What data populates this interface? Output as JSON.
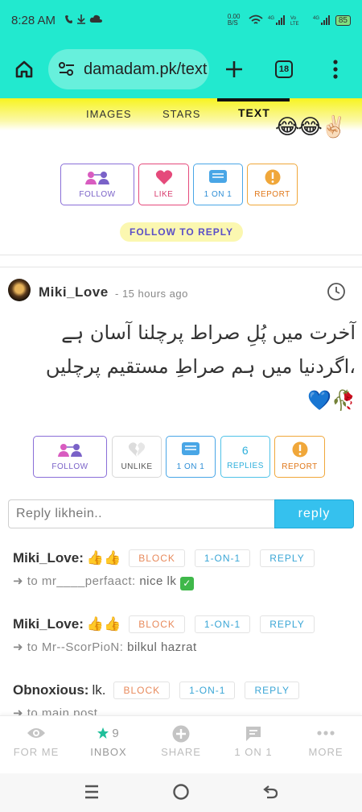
{
  "status_bar": {
    "time": "8:28 AM",
    "network_speed": "0.00 B/S",
    "battery": "85"
  },
  "browser": {
    "url": "damadam.pk/text",
    "tab_count": "18"
  },
  "nav_tabs": [
    {
      "label": "IMAGES"
    },
    {
      "label": "STARS"
    },
    {
      "label": "TEXT"
    }
  ],
  "top_emojis": "😂😂✌🏻",
  "prev_post_actions": {
    "follow": "FOLLOW",
    "like": "LIKE",
    "one_on_one": "1 ON 1",
    "report": "REPORT",
    "follow_to_reply": "FOLLOW TO REPLY"
  },
  "post": {
    "username": "Miki_Love",
    "time": "- 15 hours ago",
    "text_line1": "آخرت میں پُلِ صراط پرچلنا آسان ہے",
    "text_line2": "،اگردنیا میں ہم صراطِ مستقیم پرچلیں",
    "text_line3": "🥀💙",
    "actions": {
      "follow": "FOLLOW",
      "unlike": "UNLIKE",
      "one_on_one": "1 ON 1",
      "replies_count": "6",
      "replies": "REPLIES",
      "report": "REPORT"
    }
  },
  "reply_form": {
    "placeholder": "Reply likhein..",
    "button": "reply"
  },
  "comments": [
    {
      "name": "Miki_Love:",
      "text": "👍👍",
      "block": "BLOCK",
      "one_on_one": "1-ON-1",
      "reply": "REPLY",
      "arrow": "➜ to",
      "target": "mr____perfaact:",
      "message": "nice lk",
      "has_check": true
    },
    {
      "name": "Miki_Love:",
      "text": "👍👍",
      "block": "BLOCK",
      "one_on_one": "1-ON-1",
      "reply": "REPLY",
      "arrow": "➜ to",
      "target": "Mr--ScorPioN:",
      "message": "bilkul hazrat",
      "has_check": false
    },
    {
      "name": "Obnoxious:",
      "text": "lk.",
      "block": "BLOCK",
      "one_on_one": "1-ON-1",
      "reply": "REPLY",
      "arrow": "➜ to",
      "target": "main post",
      "message": "",
      "has_check": false
    }
  ],
  "bottom_nav": [
    {
      "label": "FOR ME",
      "icon": "eye-icon"
    },
    {
      "label": "INBOX",
      "icon": "star-icon",
      "count": "9"
    },
    {
      "label": "SHARE",
      "icon": "plus-circle-icon"
    },
    {
      "label": "1 ON 1",
      "icon": "chat-icon"
    },
    {
      "label": "MORE",
      "icon": "dots-icon"
    }
  ],
  "colors": {
    "accent": "#22e9cf",
    "follow": "#7a62c8",
    "like": "#d83a6d",
    "one_on_one": "#2f8fd6",
    "report": "#e0781a",
    "reply_button": "#35c1ee"
  }
}
